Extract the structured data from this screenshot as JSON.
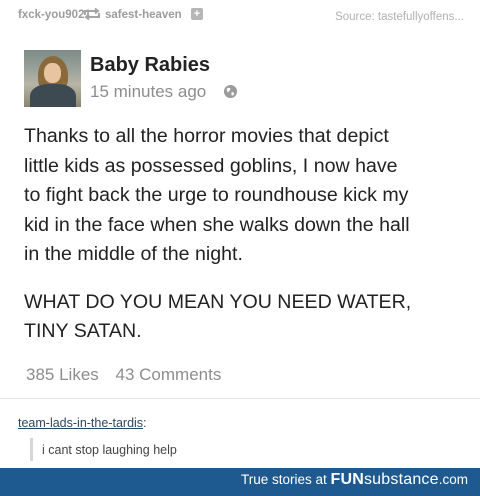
{
  "header": {
    "reblogger": "fxck-you9021",
    "reblogged_from": "safest-heaven",
    "follow_glyph": "+",
    "source": "Source: tastefullyoffens..."
  },
  "post": {
    "author": "Baby Rabies",
    "timestamp": "15 minutes ago",
    "body_p1": "Thanks to all the horror movies that depict\nlittle kids as possessed goblins, I now have\nto fight back the urge to roundhouse kick my\nkid in the face when she walks down the hall\nin the middle of the night.",
    "body_p2": "WHAT DO YOU MEAN YOU NEED WATER,\nTINY SATAN.",
    "likes": "385 Likes",
    "comments": "43 Comments"
  },
  "reply": {
    "user": "team-lads-in-the-tardis",
    "colon": ":",
    "text": "i cant stop laughing help"
  },
  "footer": {
    "tagline": "True stories at ",
    "brand_bold": "FUN",
    "brand_light": "substance",
    "brand_suffix": ".com"
  },
  "icons": [
    "reblog-icon",
    "plus-icon",
    "globe-icon"
  ],
  "colors": {
    "footer": "#1e5a90",
    "username_link": "#2c4762",
    "muted": "#8d8d8d"
  }
}
